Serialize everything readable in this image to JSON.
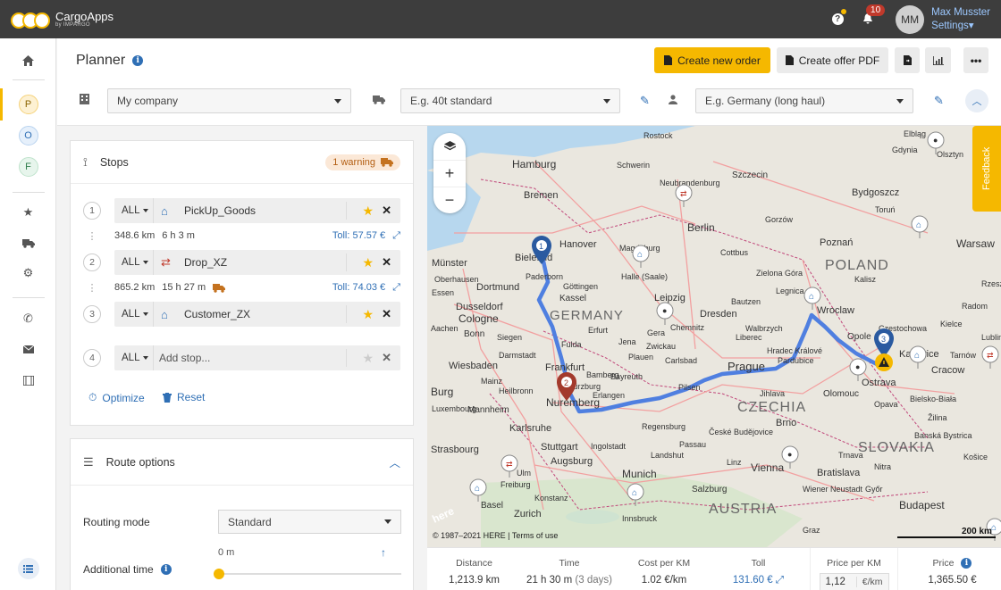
{
  "app": {
    "name": "CargoApps",
    "sub": "by IMPARGO"
  },
  "topbar": {
    "notification_count": "10",
    "initials": "MM",
    "user_name": "Max Musster",
    "settings_label": "Settings▾"
  },
  "rail": {
    "letters": [
      "P",
      "O",
      "F"
    ]
  },
  "header": {
    "title": "Planner",
    "create_order": "Create new order",
    "create_offer": "Create offer PDF",
    "company": "My company",
    "vehicle": "E.g. 40t standard",
    "profile": "E.g. Germany (long haul)"
  },
  "stops": {
    "title": "Stops",
    "warning": "1 warning",
    "items": [
      {
        "num": "1",
        "mode": "ALL",
        "name": "PickUp_Goods",
        "icon": "house-icon"
      },
      {
        "num": "2",
        "mode": "ALL",
        "name": "Drop_XZ",
        "icon": "swap-icon"
      },
      {
        "num": "3",
        "mode": "ALL",
        "name": "Customer_ZX",
        "icon": "house-icon"
      },
      {
        "num": "4",
        "mode": "ALL",
        "name": "Add stop..."
      }
    ],
    "segments": [
      {
        "km": "348.6 km",
        "dur": "6 h 3 m",
        "toll": "Toll: 57.57 €"
      },
      {
        "km": "865.2 km",
        "dur": "15 h 27 m",
        "toll": "Toll: 74.03 €"
      }
    ],
    "optimize": "Optimize",
    "reset": "Reset"
  },
  "route_options": {
    "title": "Route options",
    "routing_mode_label": "Routing mode",
    "routing_mode": "Standard",
    "additional_time_label": "Additional time",
    "additional_time": "0 m"
  },
  "map": {
    "labels": [
      "Hamburg",
      "Bremen",
      "Schwerin",
      "Rostock",
      "Szczecin",
      "Elbląg",
      "Olsztyn",
      "Berlin",
      "Hanover",
      "Bielefeld",
      "Paderborn",
      "Münster",
      "Dortmund",
      "Essen",
      "Dusseldorf",
      "Cologne",
      "Bonn",
      "GERMANY",
      "Kassel",
      "Göttingen",
      "Halle (Saale)",
      "Leipzig",
      "Dresden",
      "Chemnitz",
      "Wroclaw",
      "POLAND",
      "Poznań",
      "Bydgoszcz",
      "Toruń",
      "Warsaw",
      "Kalisz",
      "Opole",
      "Czestochowa",
      "Katowice",
      "Cracow",
      "Rzeszów",
      "Ostrava",
      "Olomouc",
      "Prague",
      "Pilsen",
      "Carlsbad",
      "CZECHIA",
      "Brno",
      "Frankfurt",
      "Wiesbaden",
      "Mainz",
      "Mannheim",
      "Nuremberg",
      "Würzburg",
      "Karlsruhe",
      "Stuttgart",
      "Strasbourg",
      "Ingolstadt",
      "Regensburg",
      "Augsburg",
      "Munich",
      "Freiburg",
      "Basel",
      "Zurich",
      "Innsbruck",
      "Salzburg",
      "AUSTRIA",
      "Linz",
      "Vienna",
      "Bratislava",
      "SLOVAKIA",
      "Budapest",
      "Bielsko-Biała",
      "Košice",
      "Luxembourg",
      "Konstanz",
      "Burg",
      "Wiener Neustadt",
      "Graz",
      "Győr",
      "Zielona Góra",
      "Cottbus",
      "Legnica",
      "Walbrzych",
      "Gorzów",
      "Neubrandenburg",
      "Kielce",
      "Radom",
      "Lublin",
      "Gdynia",
      "Magdeburg",
      "Erfurt",
      "Jena",
      "Gera",
      "Zwickau",
      "Plauen",
      "Liberec",
      "Hradec Králové",
      "Pardubice",
      "Jihlava",
      "České Budějovice",
      "Passau",
      "Landshut",
      "Ulm",
      "Heilbronn",
      "Darmstadt",
      "Fulda",
      "Siegen",
      "Aachen",
      "Bamberg",
      "Bayreuth",
      "Erlangen",
      "Bautzen",
      "Opava",
      "Žilina",
      "Banská Bystrica",
      "Nitra",
      "Trnava",
      "Tarnów",
      "Oberhausen"
    ],
    "attribution": "© 1987–2021 HERE | Terms of use",
    "scale": "200 km",
    "here_logo": "here",
    "feedback": "Feedback",
    "markers": [
      "1",
      "2",
      "3"
    ]
  },
  "stats": {
    "distance_label": "Distance",
    "distance": "1,213.9 km",
    "time_label": "Time",
    "time": "21 h 30 m",
    "time_days": "(3 days)",
    "cost_label": "Cost per KM",
    "cost": "1.02 €/km",
    "toll_label": "Toll",
    "toll": "131.60 €",
    "ppk_label": "Price per KM",
    "ppk_value": "1,12",
    "ppk_unit": "€/km",
    "price_label": "Price",
    "price": "1,365.50 €"
  },
  "colors": {
    "accent": "#f5b800",
    "link": "#2f6fb5",
    "route": "#4f7fe0",
    "topbar": "#3d3d3d"
  }
}
